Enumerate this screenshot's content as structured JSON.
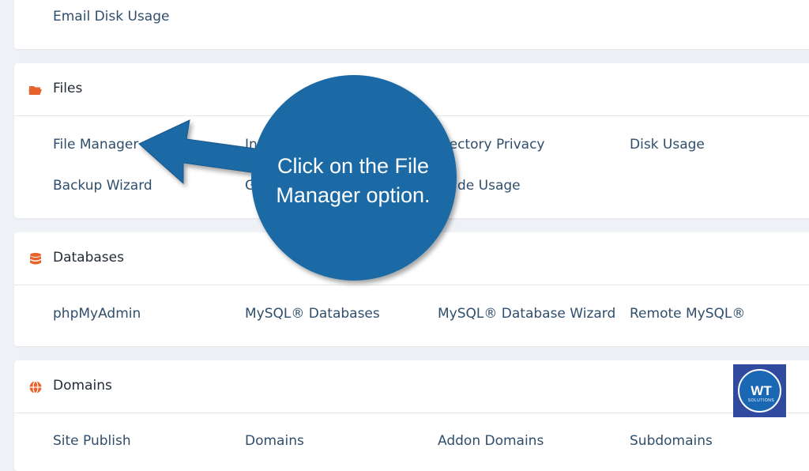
{
  "email_section": {
    "links": [
      "Email Disk Usage"
    ]
  },
  "files_section": {
    "title": "Files",
    "icon": "folder-open-icon",
    "links": [
      "File Manager",
      "In",
      "rectory Privacy",
      "Disk Usage",
      "Backup Wizard",
      "G",
      "de Usage"
    ]
  },
  "databases_section": {
    "title": "Databases",
    "icon": "database-icon",
    "links": [
      "phpMyAdmin",
      "MySQL® Databases",
      "MySQL® Database Wizard",
      "Remote MySQL®"
    ]
  },
  "domains_section": {
    "title": "Domains",
    "icon": "globe-icon",
    "links": [
      "Site Publish",
      "Domains",
      "Addon Domains",
      "Subdomains"
    ]
  },
  "callout": {
    "line1": "Click on the File",
    "line2": "Manager option."
  },
  "logo": {
    "main": "WT",
    "sub": "SOLUTIONS"
  },
  "colors": {
    "accent": "#e8622b",
    "callout_blue": "#1b6aa5",
    "link": "#2f4e6c"
  }
}
